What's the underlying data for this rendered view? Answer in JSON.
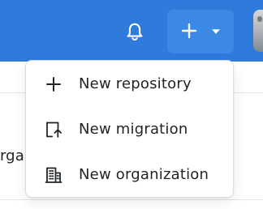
{
  "header": {
    "notifications_icon": "bell-icon",
    "create_icon": "plus-icon",
    "dropdown_icon": "chevron-down-icon",
    "avatar": "avatar"
  },
  "background": {
    "partial_text": "rga"
  },
  "create_menu": {
    "items": [
      {
        "label": "New repository",
        "icon": "plus-icon"
      },
      {
        "label": "New migration",
        "icon": "migration-icon"
      },
      {
        "label": "New organization",
        "icon": "organization-icon"
      }
    ]
  },
  "colors": {
    "header": "#2f7bdc",
    "header_button": "#3b89e4",
    "menu_text": "#1e2328",
    "menu_border": "#d8dde2"
  }
}
